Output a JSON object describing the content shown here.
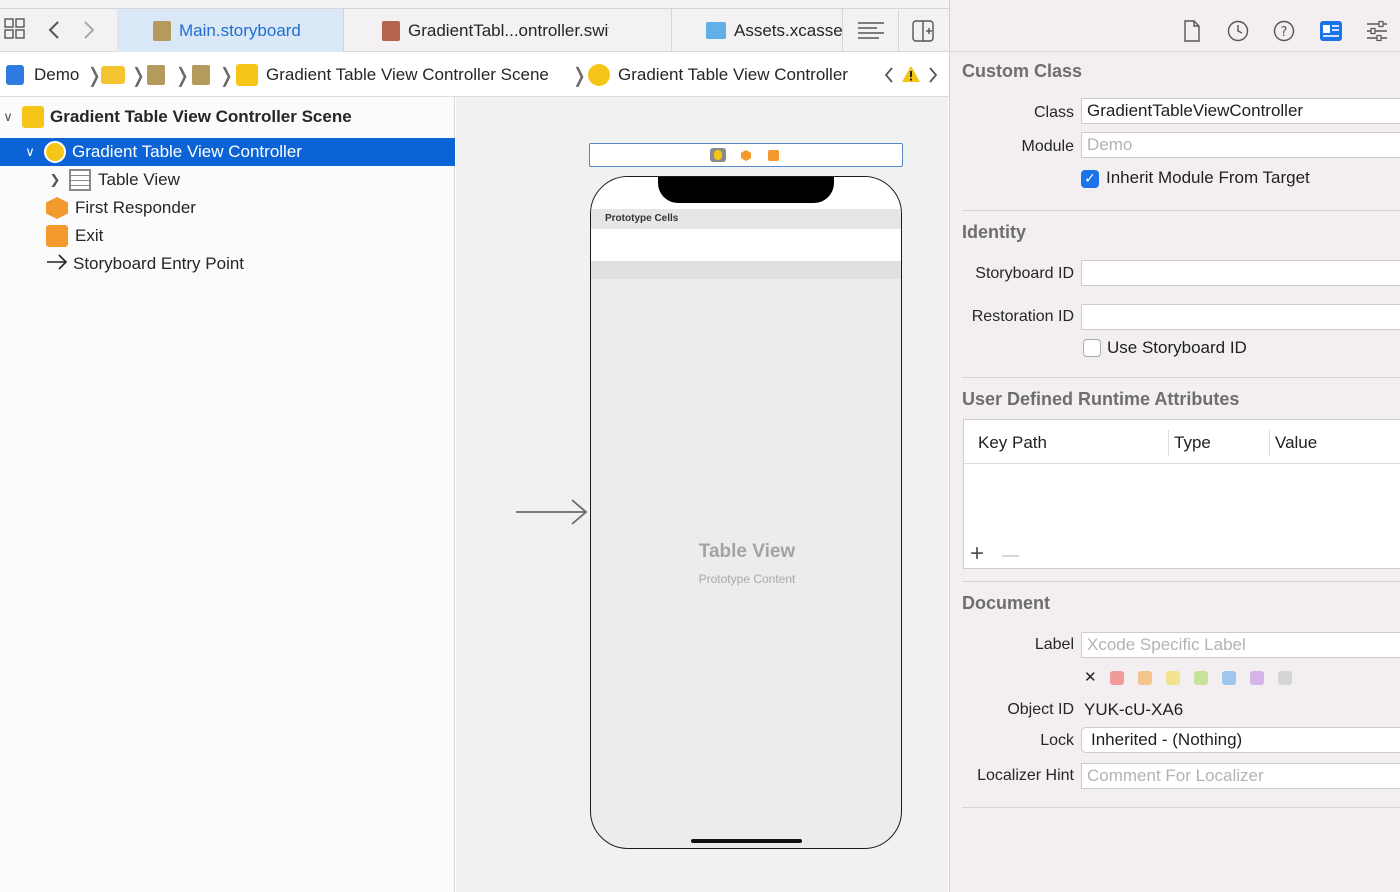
{
  "tabs": [
    {
      "label": "Main.storyboard",
      "icon": "storyboard-file-icon",
      "active": true
    },
    {
      "label": "GradientTabl...ontroller.swift",
      "icon": "swift-file-icon",
      "active": false
    },
    {
      "label": "Assets.xcasse",
      "icon": "asset-catalog-icon",
      "active": false
    }
  ],
  "breadcrumb": {
    "project": "Demo",
    "scene": "Gradient Table View Controller Scene",
    "controller": "Gradient Table View Controller"
  },
  "outline": {
    "scene": "Gradient Table View Controller Scene",
    "items": [
      {
        "label": "Gradient Table View Controller",
        "icon": "view-controller-icon"
      },
      {
        "label": "Table View",
        "icon": "table-view-icon"
      },
      {
        "label": "First Responder",
        "icon": "first-responder-icon"
      },
      {
        "label": "Exit",
        "icon": "exit-icon"
      },
      {
        "label": "Storyboard Entry Point",
        "icon": "entry-arrow-icon"
      }
    ]
  },
  "canvas": {
    "prototype_header": "Prototype Cells",
    "table_title": "Table View",
    "table_subtitle": "Prototype Content"
  },
  "inspector": {
    "custom_class": {
      "title": "Custom Class",
      "class_label": "Class",
      "class_value": "GradientTableViewController",
      "module_label": "Module",
      "module_placeholder": "Demo",
      "inherit_label": "Inherit Module From Target",
      "inherit_checked": true
    },
    "identity": {
      "title": "Identity",
      "storyboard_id_label": "Storyboard ID",
      "storyboard_id_value": "",
      "restoration_id_label": "Restoration ID",
      "restoration_id_value": "",
      "use_storyboard_label": "Use Storyboard ID",
      "use_storyboard_checked": false
    },
    "runtime_attributes": {
      "title": "User Defined Runtime Attributes",
      "columns": [
        "Key Path",
        "Type",
        "Value"
      ],
      "rows": [],
      "add_symbol": "+",
      "remove_symbol": "—"
    },
    "document": {
      "title": "Document",
      "label_label": "Label",
      "label_placeholder": "Xcode Specific Label",
      "colors": [
        "#f09a9a",
        "#f5c48a",
        "#f2e48e",
        "#c7e39a",
        "#9fc6ef",
        "#d6b4ea",
        "#d4d4d4"
      ],
      "clear_symbol": "✕",
      "object_id_label": "Object ID",
      "object_id_value": "YUK-cU-XA6",
      "lock_label": "Lock",
      "lock_value": "Inherited - (Nothing)",
      "hint_label": "Localizer Hint",
      "hint_placeholder": "Comment For Localizer"
    }
  }
}
